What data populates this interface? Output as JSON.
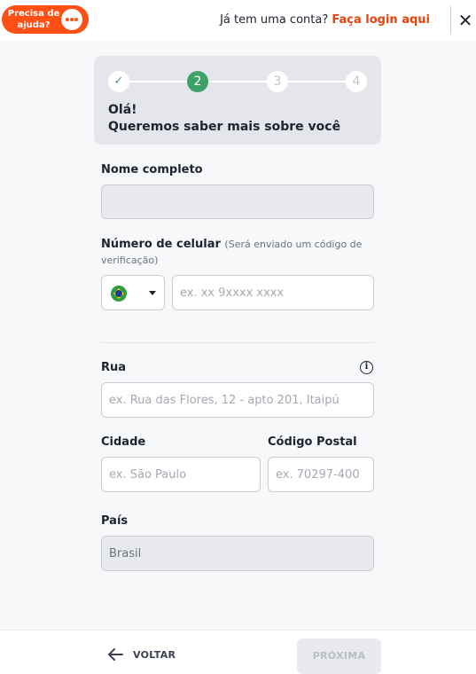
{
  "header": {
    "help_label": "Precisa de ajuda?",
    "have_account_text": "Já tem uma conta?",
    "login_link": "Faça login aqui",
    "close_glyph": "✕"
  },
  "stepper": {
    "steps": [
      {
        "label": "✓",
        "state": "done"
      },
      {
        "label": "2",
        "state": "active"
      },
      {
        "label": "3",
        "state": "pending"
      },
      {
        "label": "4",
        "state": "pending"
      }
    ],
    "greeting": "Olá!",
    "subtitle": "Queremos saber mais sobre você"
  },
  "form": {
    "full_name": {
      "label": "Nome completo",
      "value": "",
      "placeholder": ""
    },
    "phone": {
      "label": "Número de celular",
      "hint_part1": "(Será enviado um código de",
      "hint_part2": "verificação)",
      "country": "Brasil",
      "placeholder": "ex. xx 9xxxx xxxx",
      "value": ""
    },
    "street": {
      "label": "Rua",
      "placeholder": "ex. Rua das Flores, 12 - apto 201, Itaipú",
      "value": ""
    },
    "city": {
      "label": "Cidade",
      "placeholder": "ex. São Paulo",
      "value": ""
    },
    "postal_code": {
      "label": "Código Postal",
      "placeholder": "ex. 70297-400",
      "value": ""
    },
    "country": {
      "label": "País",
      "value": "Brasil"
    }
  },
  "footer": {
    "back_label": "VOLTAR",
    "next_label": "PRÓXIMA"
  },
  "colors": {
    "brand_orange": "#ff4f14",
    "link_orange": "#e8430e",
    "step_green": "#3fa16a"
  }
}
